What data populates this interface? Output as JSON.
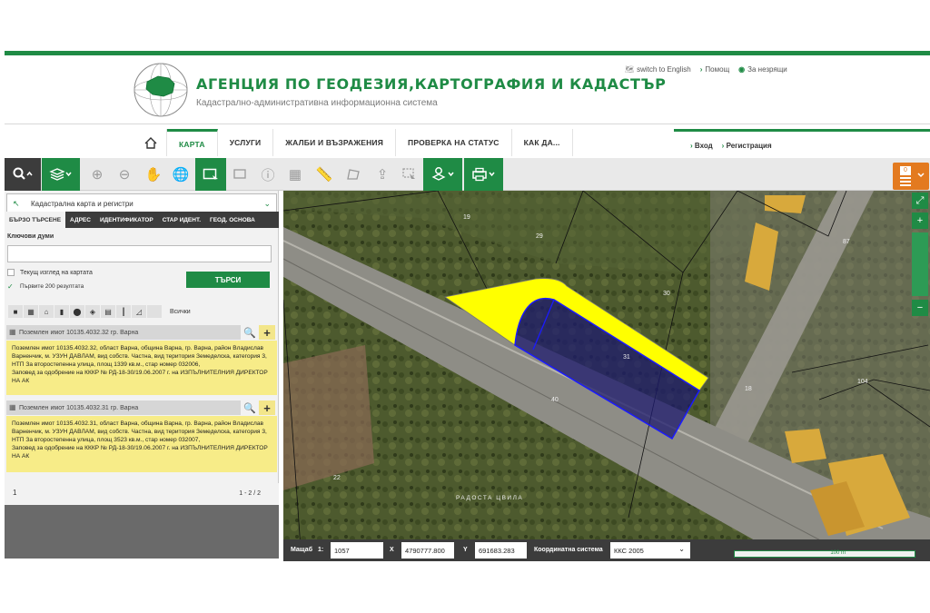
{
  "header": {
    "agency_title": "АГЕНЦИЯ ПО ГЕОДЕЗИЯ,КАРТОГРАФИЯ И КАДАСТЪР",
    "subtitle": "Кадастрално-административна информационна система",
    "lang_link": "switch to English",
    "help_link": "Помощ",
    "accessibility_link": "За незрящи"
  },
  "nav": {
    "items": [
      "КАРТА",
      "УСЛУГИ",
      "ЖАЛБИ И ВЪЗРАЖЕНИЯ",
      "ПРОВЕРКА НА СТАТУС",
      "КАК ДА..."
    ],
    "active": "КАРТА",
    "login": "Вход",
    "register": "Регистрация"
  },
  "toolbar": {
    "icons": [
      "search-icon",
      "layers-icon",
      "zoom-in-icon",
      "zoom-out-icon",
      "pan-hand-icon",
      "globe-icon",
      "select-rect-icon",
      "select-area-icon",
      "info-icon",
      "table-icon",
      "ruler-icon",
      "area-measure-icon",
      "upload-icon",
      "select-cursor-icon",
      "map-pin-icon",
      "print-icon"
    ],
    "notification_count": "0"
  },
  "panel": {
    "layer_select": "Кадастрална карта и регистри",
    "tabs": [
      "БЪРЗО ТЪРСЕНЕ",
      "АДРЕС",
      "ИДЕНТИФИКАТОР",
      "СТАР ИДЕНТ.",
      "ГЕОД. ОСНОВА"
    ],
    "keywords_label": "Ключови думи",
    "keywords_value": "",
    "current_view_label": "Текущ изглед на картата",
    "first_200_label": "Първите 200 резултата",
    "search_button": "ТЪРСИ",
    "filter_all_label": "Всички"
  },
  "results": [
    {
      "title": "Поземлен имот 10135.4032.32 гр. Варна",
      "body": "Поземлен имот 10135.4032.32, област Варна, община Варна, гр. Варна, район Владислав Варненчик, м. УЗУН ДАВЛАМ, вид собств. Частна, вид територия Земеделска, категория 3, НТП За второстепенна улица, площ 1339 кв.м., стар номер 032006,",
      "order": "Заповед за одобрение на КККР № РД-18-30/19.06.2007 г. на ИЗПЪЛНИТЕЛНИЯ ДИРЕКТОР НА АК"
    },
    {
      "title": "Поземлен имот 10135.4032.31 гр. Варна",
      "body": "Поземлен имот 10135.4032.31, област Варна, община Варна, гр. Варна, район Владислав Варненчик, м. УЗУН ДАВЛАМ, вид собств. Частна, вид територия Земеделска, категория 3, НТП За второстепенна улица, площ 3523 кв.м., стар номер 032007,",
      "order": "Заповед за одобрение на КККР № РД-18-30/19.06.2007 г. на ИЗПЪЛНИТЕЛНИЯ ДИРЕКТОР НА АК"
    }
  ],
  "pager": {
    "page": "1",
    "range": "1 - 2 / 2"
  },
  "map": {
    "parcel_labels": [
      "19",
      "29",
      "30",
      "31",
      "40",
      "18",
      "104",
      "87",
      "22"
    ],
    "street_label": "РАДОСТА ЦВИЛА",
    "highlight_color": "#ffff00",
    "selection_color": "#1a1aff"
  },
  "statusbar": {
    "scale_label": "Мащаб",
    "scale_prefix": "1:",
    "scale_value": "1057",
    "x_label": "X",
    "x_value": "4790777.800",
    "y_label": "Y",
    "y_value": "691683.283",
    "crs_label": "Координатна система",
    "crs_value": "ККС 2005",
    "scale_bar": "100 m"
  }
}
